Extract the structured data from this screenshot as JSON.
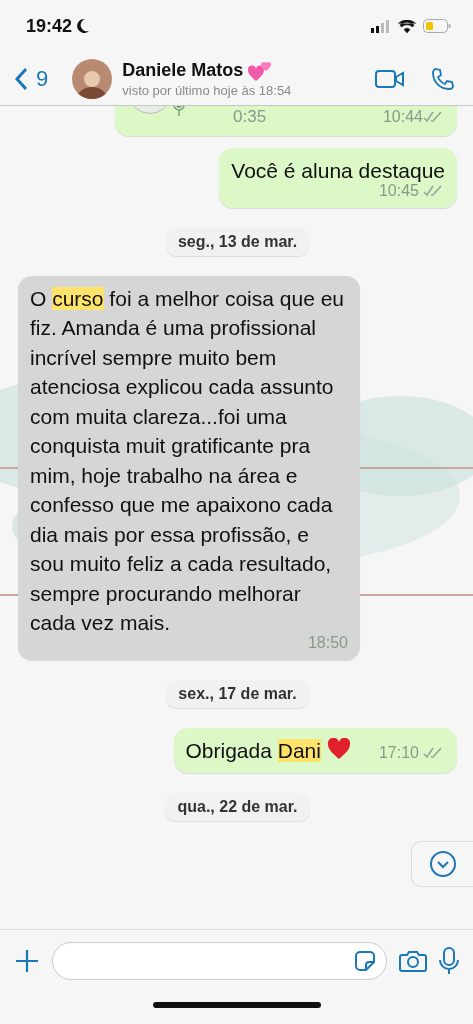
{
  "status_bar": {
    "time": "19:42"
  },
  "header": {
    "back_count": "9",
    "contact_name": "Daniele Matos",
    "last_seen": "visto por último hoje às 18:54"
  },
  "messages": [
    {
      "kind": "voice",
      "outgoing": true,
      "duration": "0:35",
      "time": "10:44",
      "read": true
    },
    {
      "kind": "text",
      "outgoing": true,
      "parts": [
        {
          "text": "Você é aluna destaque",
          "highlight": false
        }
      ],
      "time": "10:45",
      "read": true
    },
    {
      "kind": "date",
      "label": "seg., 13 de mar."
    },
    {
      "kind": "text",
      "outgoing": false,
      "parts": [
        {
          "text": "O ",
          "highlight": false
        },
        {
          "text": "curso",
          "highlight": true
        },
        {
          "text": " foi a melhor coisa que eu fiz. Amanda é uma profissional incrível sempre muito bem atenciosa explicou cada assunto com muita clareza...foi uma conquista muit gratificante pra mim, hoje trabalho na área e confesso que me apaixono cada dia mais por essa profissão, e sou muito feliz a cada resultado, sempre procurando melhorar cada vez mais.",
          "highlight": false
        }
      ],
      "time": "18:50"
    },
    {
      "kind": "date",
      "label": "sex., 17 de mar."
    },
    {
      "kind": "text",
      "outgoing": true,
      "parts": [
        {
          "text": "Obrigada ",
          "highlight": false
        },
        {
          "text": "Dani",
          "highlight": true
        }
      ],
      "time": "17:10",
      "read": true,
      "heart": true
    },
    {
      "kind": "date",
      "label": "qua., 22 de mar."
    }
  ]
}
